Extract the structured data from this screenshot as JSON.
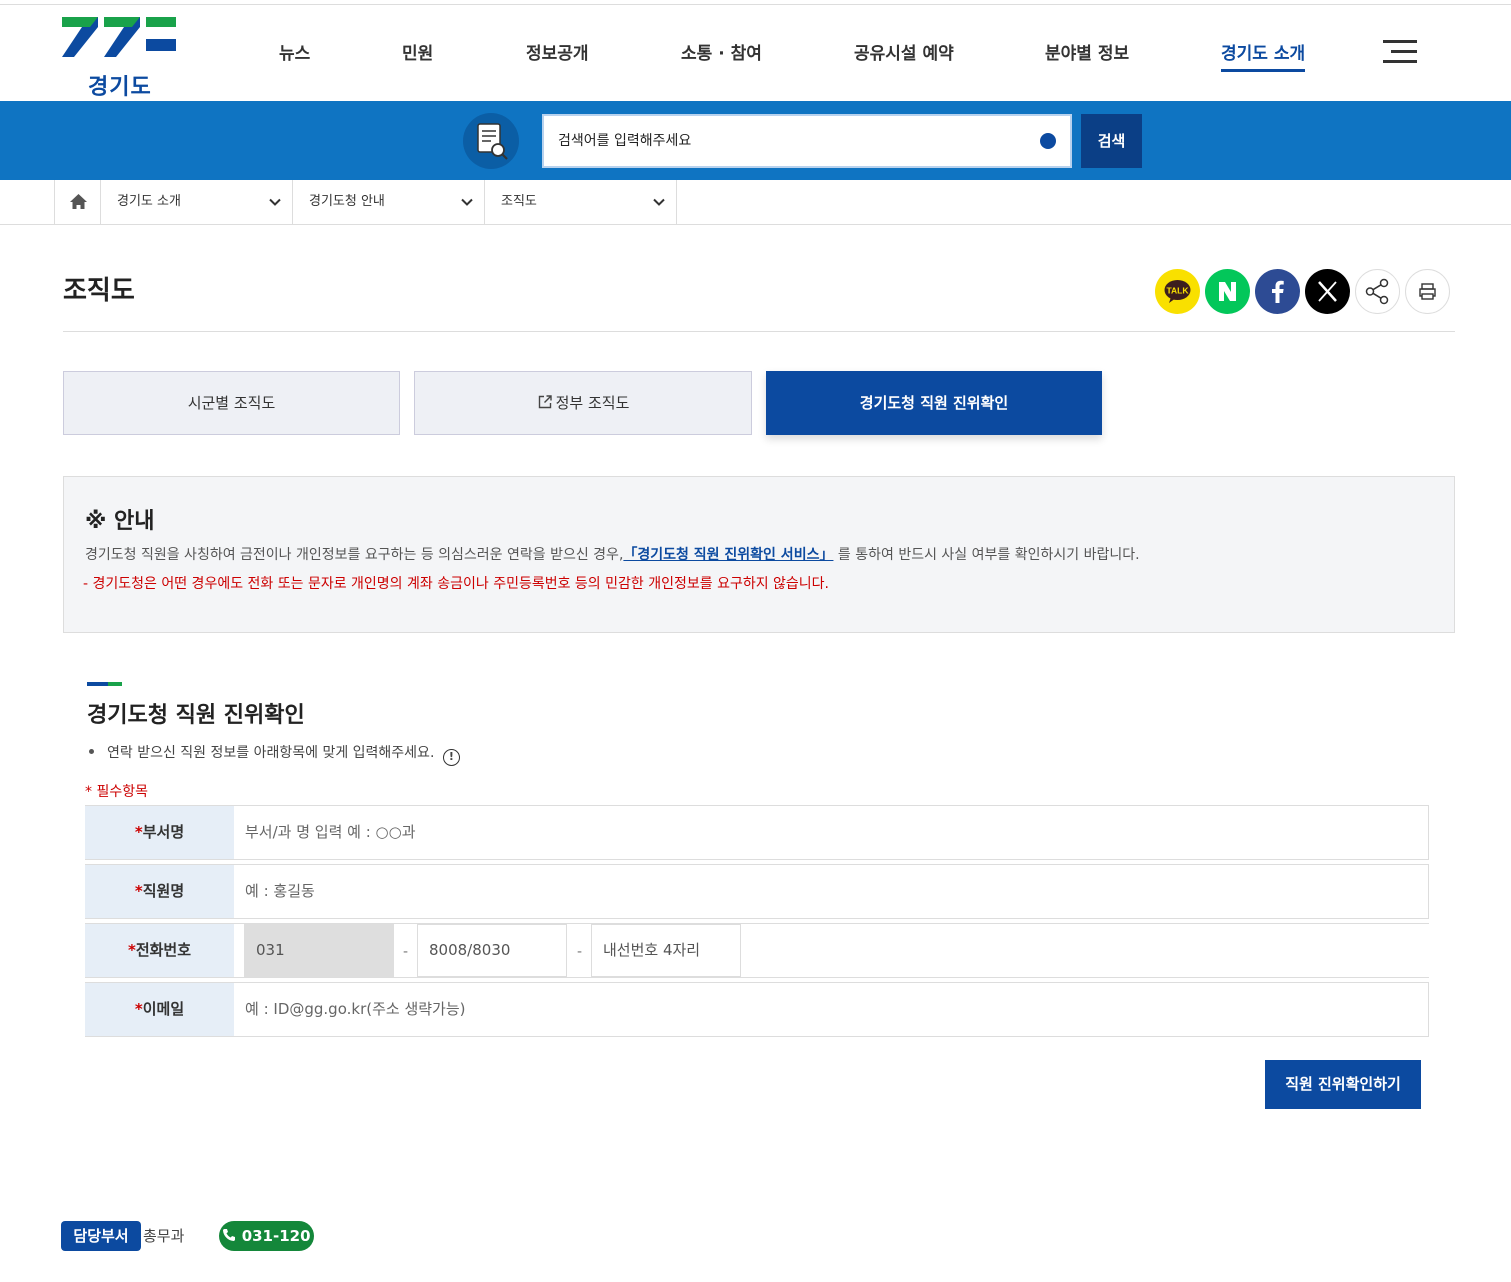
{
  "header": {
    "logo_text": "경기도",
    "nav": [
      "뉴스",
      "민원",
      "정보공개",
      "소통 · 참여",
      "공유시설 예약",
      "분야별 정보",
      "경기도 소개"
    ]
  },
  "search": {
    "placeholder": "검색어를 입력해주세요",
    "button_label": "검색"
  },
  "breadcrumb": {
    "items": [
      "경기도 소개",
      "경기도청 안내",
      "조직도"
    ]
  },
  "page": {
    "title": "조직도"
  },
  "tabs": [
    {
      "label": "시군별 조직도"
    },
    {
      "label": "정부 조직도"
    },
    {
      "label": "경기도청 직원 진위확인"
    }
  ],
  "notice": {
    "title": "※ 안내",
    "text_before": "경기도청 직원을 사칭하여 금전이나 개인정보를 요구하는 등 의심스러운 연락을 받으신 경우,",
    "link_text": "「경기도청 직원 진위확인 서비스」",
    "text_after": " 를 통하여 반드시 사실 여부를 확인하시기 바랍니다.",
    "warning": "- 경기도청은 어떤 경우에도 전화 또는 문자로 개인명의 계좌 송금이나 주민등록번호 등의 민감한 개인정보를 요구하지 않습니다."
  },
  "form": {
    "title": "경기도청 직원 진위확인",
    "description": "연락 받으신 직원 정보를 아래항목에 맞게 입력해주세요.",
    "info_glyph": "!",
    "required_note": "* 필수항목",
    "fields": {
      "dept": {
        "label": "부서명",
        "placeholder": "부서/과 명 입력 예 : ○○과"
      },
      "name": {
        "label": "직원명",
        "placeholder": "예 : 홍길동"
      },
      "phone": {
        "label": "전화번호",
        "part1": "031",
        "part2": "8008/8030",
        "part3_placeholder": "내선번호 4자리"
      },
      "email": {
        "label": "이메일",
        "placeholder": "예 : ID@gg.go.kr(주소 생략가능)"
      }
    },
    "submit_label": "직원 진위확인하기"
  },
  "footer": {
    "dept_badge": "담당부서",
    "dept_name": "총무과",
    "phone": "031-120"
  },
  "colors": {
    "primary": "#0c4aa0",
    "search_bar": "#0f74c2",
    "required": "#cc0000",
    "green": "#14873a"
  }
}
